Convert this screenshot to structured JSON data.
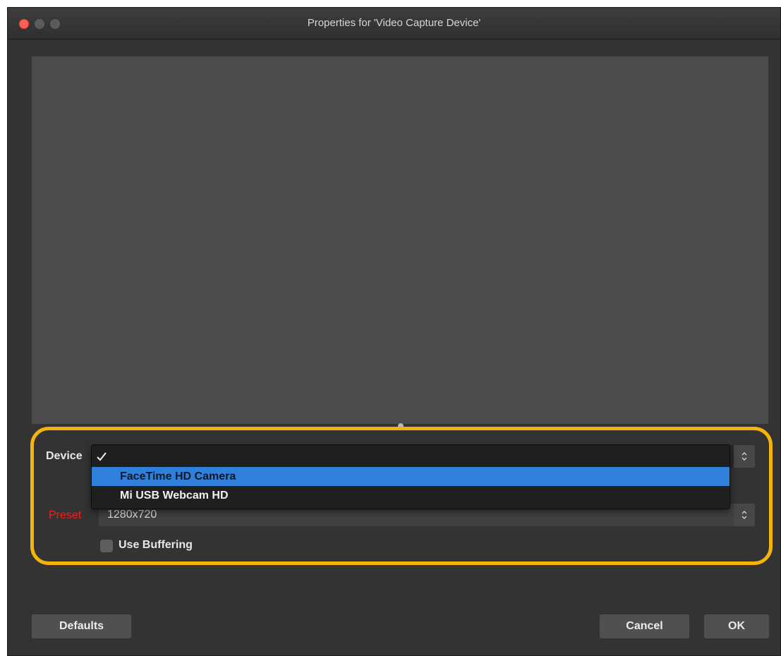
{
  "window": {
    "title": "Properties for 'Video Capture Device'"
  },
  "device": {
    "label": "Device",
    "options": [
      {
        "label": "FaceTime HD Camera",
        "highlighted": true
      },
      {
        "label": "Mi USB Webcam HD",
        "highlighted": false
      }
    ]
  },
  "preset": {
    "label": "Preset",
    "value": "1280x720"
  },
  "buffering": {
    "label": "Use Buffering",
    "checked": false
  },
  "buttons": {
    "defaults": "Defaults",
    "cancel": "Cancel",
    "ok": "OK"
  },
  "colors": {
    "highlight_outline": "#f5b40b",
    "selected_item": "#2f7fdb",
    "preset_label": "#ff1a1a",
    "close_button": "#fe5f57"
  },
  "icons": {
    "check": "check-icon",
    "stepper": "up-down-chevron-icon"
  }
}
